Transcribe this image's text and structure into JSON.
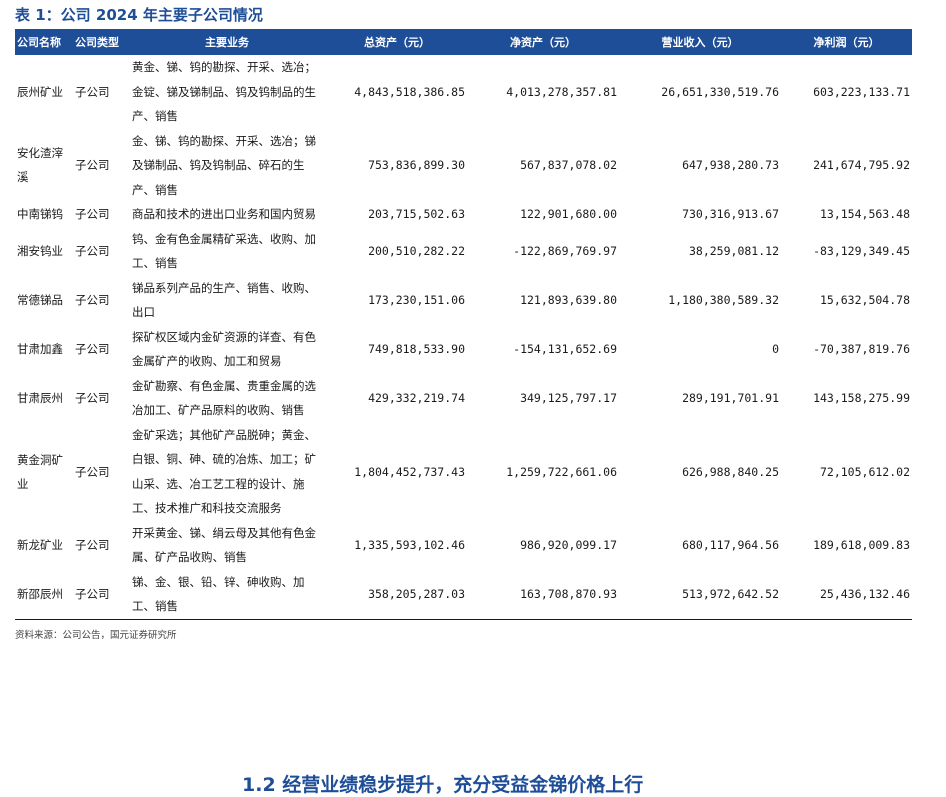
{
  "table_title": "表 1：公司 2024 年主要子公司情况",
  "columns": {
    "company": "公司名称",
    "type": "公司类型",
    "business": "主要业务",
    "total_assets": "总资产（元）",
    "net_assets": "净资产（元）",
    "revenue": "营业收入（元）",
    "net_profit": "净利润（元）"
  },
  "rows": [
    {
      "company": "辰州矿业",
      "type": "子公司",
      "business": "黄金、锑、钨的勘探、开采、选冶；金锭、锑及锑制品、钨及钨制品的生产、销售",
      "total_assets": "4,843,518,386.85",
      "net_assets": "4,013,278,357.81",
      "revenue": "26,651,330,519.76",
      "net_profit": "603,223,133.71"
    },
    {
      "company": "安化渣滓溪",
      "type": "子公司",
      "business": "金、锑、钨的勘探、开采、选冶；锑及锑制品、钨及钨制品、碎石的生产、销售",
      "total_assets": "753,836,899.30",
      "net_assets": "567,837,078.02",
      "revenue": "647,938,280.73",
      "net_profit": "241,674,795.92"
    },
    {
      "company": "中南锑钨",
      "type": "子公司",
      "business": "商品和技术的进出口业务和国内贸易",
      "total_assets": "203,715,502.63",
      "net_assets": "122,901,680.00",
      "revenue": "730,316,913.67",
      "net_profit": "13,154,563.48"
    },
    {
      "company": "湘安钨业",
      "type": "子公司",
      "business": "钨、金有色金属精矿采选、收购、加工、销售",
      "total_assets": "200,510,282.22",
      "net_assets": "-122,869,769.97",
      "revenue": "38,259,081.12",
      "net_profit": "-83,129,349.45"
    },
    {
      "company": "常德锑品",
      "type": "子公司",
      "business": "锑品系列产品的生产、销售、收购、出口",
      "total_assets": "173,230,151.06",
      "net_assets": "121,893,639.80",
      "revenue": "1,180,380,589.32",
      "net_profit": "15,632,504.78"
    },
    {
      "company": "甘肃加鑫",
      "type": "子公司",
      "business": "探矿权区域内金矿资源的详查、有色金属矿产的收购、加工和贸易",
      "total_assets": "749,818,533.90",
      "net_assets": "-154,131,652.69",
      "revenue": "0",
      "net_profit": "-70,387,819.76"
    },
    {
      "company": "甘肃辰州",
      "type": "子公司",
      "business": "金矿勘察、有色金属、贵重金属的选冶加工、矿产品原料的收购、销售",
      "total_assets": "429,332,219.74",
      "net_assets": "349,125,797.17",
      "revenue": "289,191,701.91",
      "net_profit": "143,158,275.99"
    },
    {
      "company": "黄金洞矿业",
      "type": "子公司",
      "business": "金矿采选；其他矿产品脱砷；黄金、白银、铜、砷、硫的冶炼、加工；矿山采、选、冶工艺工程的设计、施工、技术推广和科技交流服务",
      "total_assets": "1,804,452,737.43",
      "net_assets": "1,259,722,661.06",
      "revenue": "626,988,840.25",
      "net_profit": "72,105,612.02"
    },
    {
      "company": "新龙矿业",
      "type": "子公司",
      "business": "开采黄金、锑、绢云母及其他有色金属、矿产品收购、销售",
      "total_assets": "1,335,593,102.46",
      "net_assets": "986,920,099.17",
      "revenue": "680,117,964.56",
      "net_profit": "189,618,009.83"
    },
    {
      "company": "新邵辰州",
      "type": "子公司",
      "business": "锑、金、银、铅、锌、砷收购、加工、销售",
      "total_assets": "358,205,287.03",
      "net_assets": "163,708,870.93",
      "revenue": "513,972,642.52",
      "net_profit": "25,436,132.46"
    }
  ],
  "source": "资料来源：公司公告，国元证券研究所",
  "next_heading": "1.2 经营业绩稳步提升，充分受益金锑价格上行"
}
